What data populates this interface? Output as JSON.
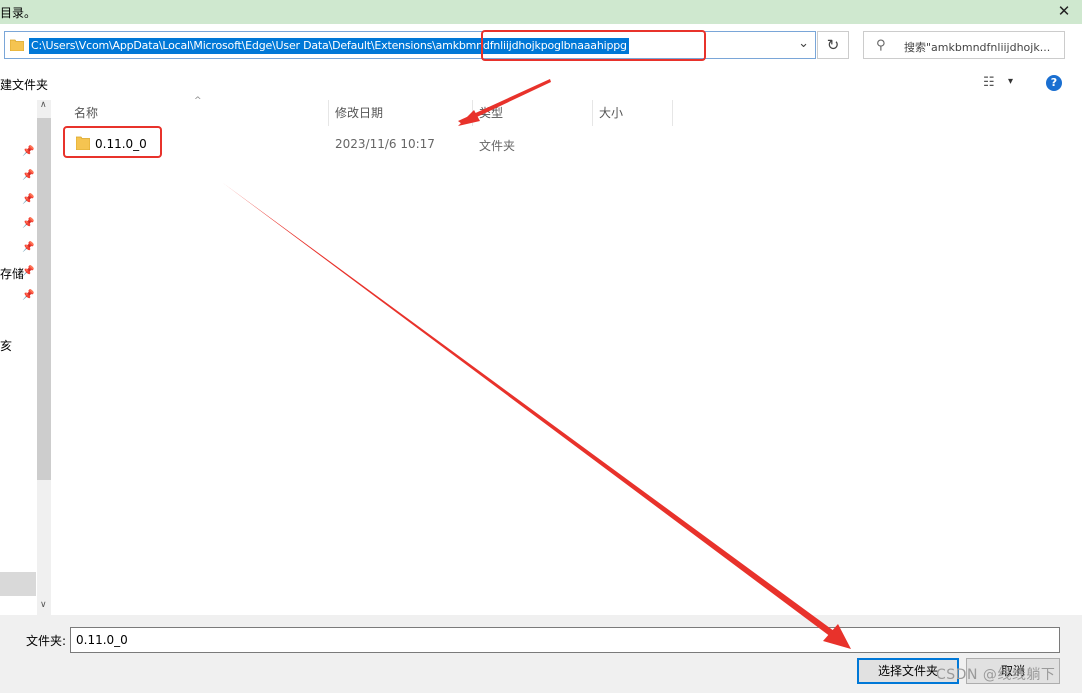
{
  "window": {
    "title": "目录。",
    "close_glyph": "✕"
  },
  "address": {
    "path": "C:\\Users\\Vcom\\AppData\\Local\\Microsoft\\Edge\\User Data\\Default\\Extensions\\amkbmndfnliijdhojkpoglbnaaahippg",
    "dropdown_glyph": "⌄"
  },
  "refresh_glyph": "↻",
  "search": {
    "text": "搜索\"amkbmndfnliijdhojk...",
    "icon_glyph": "⚲"
  },
  "toolbar": {
    "new_folder_label": "建文件夹",
    "view_glyph": "☷",
    "caret": "▾",
    "help_glyph": "?"
  },
  "nav": {
    "pin_glyph": "📌",
    "storage_label": "存储",
    "item_label": "亥",
    "scroll_up": "∧",
    "scroll_down": "∨"
  },
  "columns": {
    "name": "名称",
    "modified": "修改日期",
    "type": "类型",
    "size": "大小",
    "sort_glyph": "^"
  },
  "files": [
    {
      "name": "0.11.0_0",
      "modified": "2023/11/6 10:17",
      "type": "文件夹",
      "size": ""
    }
  ],
  "footer": {
    "folder_label": "文件夹:",
    "folder_value": "0.11.0_0",
    "select_button": "选择文件夹",
    "cancel_button": "取消"
  },
  "watermark": "CSDN @线线躺下",
  "colors": {
    "highlight": "#0078d7",
    "annotation": "#e8322b",
    "titlebar": "#cfe8cf"
  }
}
